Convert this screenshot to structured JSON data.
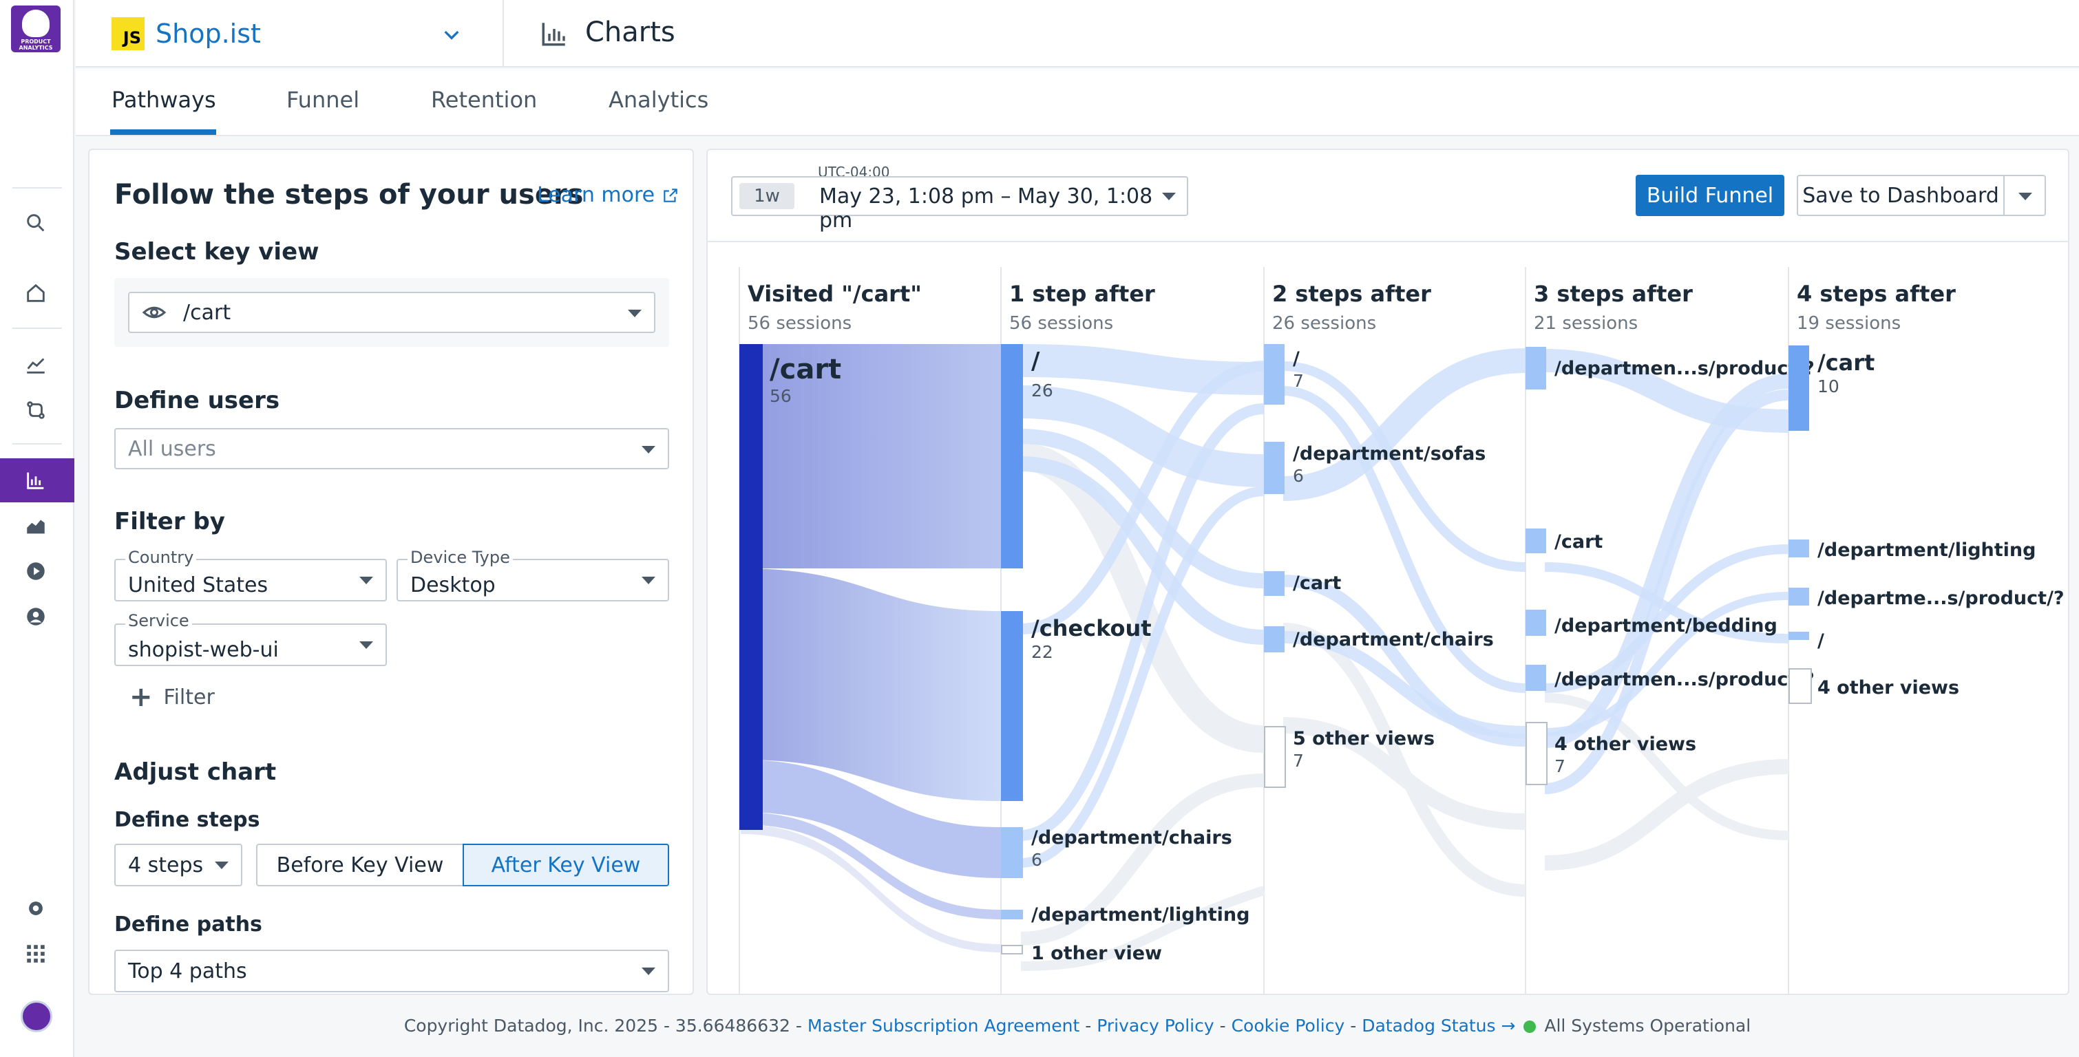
{
  "rail": {
    "logo_text_1": "PRODUCT",
    "logo_text_2": "ANALYTICS"
  },
  "topbar": {
    "app_badge": "JS",
    "app_name": "Shop.ist",
    "section_title": "Charts"
  },
  "tabs": [
    {
      "label": "Pathways",
      "active": true
    },
    {
      "label": "Funnel",
      "active": false
    },
    {
      "label": "Retention",
      "active": false
    },
    {
      "label": "Analytics",
      "active": false
    }
  ],
  "left_panel": {
    "title": "Follow the steps of your users",
    "learn_more": "Learn more",
    "key_view_heading": "Select key view",
    "key_view_value": "/cart",
    "define_users_heading": "Define users",
    "users_placeholder": "All users",
    "filter_heading": "Filter by",
    "country_label": "Country",
    "country_value": "United States",
    "device_label": "Device Type",
    "device_value": "Desktop",
    "service_label": "Service",
    "service_value": "shopist-web-ui",
    "add_filter": "Filter",
    "adjust_heading": "Adjust chart",
    "steps_heading": "Define steps",
    "steps_value": "4 steps",
    "before_key_view": "Before Key View",
    "after_key_view": "After Key View",
    "paths_heading": "Define paths",
    "paths_value": "Top 4 paths"
  },
  "chart_toolbar": {
    "timezone": "UTC-04:00",
    "range_pill": "1w",
    "range_text": "May 23, 1:08 pm – May 30, 1:08 pm",
    "build_funnel": "Build Funnel",
    "save_dashboard": "Save to Dashboard"
  },
  "chart_data": {
    "type": "sankey",
    "columns": [
      {
        "title": "Visited \"/cart\"",
        "subtitle": "56 sessions",
        "nodes": [
          {
            "label": "/cart",
            "value": "56"
          }
        ]
      },
      {
        "title": "1 step after",
        "subtitle": "56 sessions",
        "nodes": [
          {
            "label": "/",
            "value": "26"
          },
          {
            "label": "/checkout",
            "value": "22"
          },
          {
            "label": "/department/chairs",
            "value": "6"
          },
          {
            "label": "/department/lighting",
            "value": ""
          },
          {
            "label": "1 other view",
            "value": ""
          }
        ]
      },
      {
        "title": "2 steps after",
        "subtitle": "26 sessions",
        "nodes": [
          {
            "label": "/",
            "value": "7"
          },
          {
            "label": "/department/sofas",
            "value": "6"
          },
          {
            "label": "/cart",
            "value": ""
          },
          {
            "label": "/department/chairs",
            "value": ""
          },
          {
            "label": "5 other views",
            "value": "7"
          }
        ]
      },
      {
        "title": "3 steps after",
        "subtitle": "21 sessions",
        "nodes": [
          {
            "label": "/departmen...s/product/?",
            "value": ""
          },
          {
            "label": "/cart",
            "value": ""
          },
          {
            "label": "/department/bedding",
            "value": ""
          },
          {
            "label": "/departmen...s/product/?",
            "value": ""
          },
          {
            "label": "4 other views",
            "value": "7"
          }
        ]
      },
      {
        "title": "4 steps after",
        "subtitle": "19 sessions",
        "nodes": [
          {
            "label": "/cart",
            "value": "10"
          },
          {
            "label": "/department/lighting",
            "value": ""
          },
          {
            "label": "/departme...s/product/?",
            "value": ""
          },
          {
            "label": "/",
            "value": ""
          },
          {
            "label": "4 other views",
            "value": ""
          }
        ]
      }
    ]
  },
  "footer": {
    "copyright": "Copyright Datadog, Inc. 2025 - 35.66486632 -",
    "msa": "Master Subscription Agreement",
    "sep": "-",
    "privacy": "Privacy Policy",
    "cookie": "Cookie Policy",
    "status_link": "Datadog Status →",
    "status_text": "All Systems Operational"
  },
  "colors": {
    "brand": "#632ca6",
    "accent": "#1473c3",
    "node_dark": "#1a2eb8",
    "node": "#5f97f0",
    "node_light": "#9ec4f8",
    "link": "#c9dcfb"
  }
}
